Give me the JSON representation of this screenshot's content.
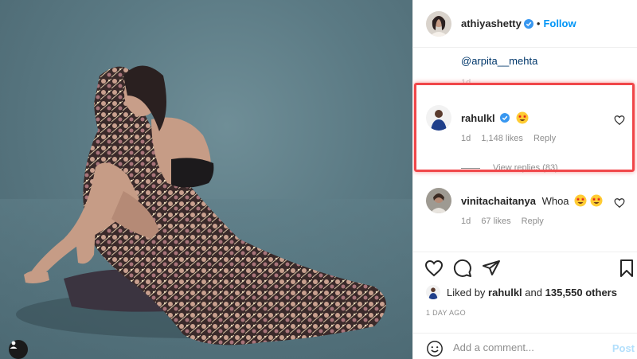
{
  "header": {
    "username": "athiyashetty",
    "follow_label": "Follow",
    "separator": "•"
  },
  "thread": {
    "mention": "@arpita__mehta",
    "mention_time": "1d"
  },
  "comments": [
    {
      "username": "rahulkl",
      "text": "",
      "emoji": "star-struck-emoji",
      "time": "1d",
      "likes": "1,148 likes",
      "reply": "Reply",
      "view_replies": "View replies (83)",
      "highlighted": true
    },
    {
      "username": "vinitachaitanya",
      "text": "Whoa",
      "emoji": "star-struck-emoji x2",
      "time": "1d",
      "likes": "67 likes",
      "reply": "Reply"
    }
  ],
  "actions": {
    "icons": [
      "heart-icon",
      "comment-icon",
      "share-icon",
      "bookmark-icon"
    ]
  },
  "likes_summary": {
    "prefix": "Liked by",
    "user": "rahulkl",
    "and": "and",
    "others": "135,550 others"
  },
  "time_ago": "1 DAY AGO",
  "add_comment": {
    "placeholder": "Add a comment...",
    "post_label": "Post"
  },
  "colors": {
    "accent_blue": "#0095f6",
    "highlight_red": "#f0474a",
    "photo_backdrop": "#5b7a84"
  }
}
